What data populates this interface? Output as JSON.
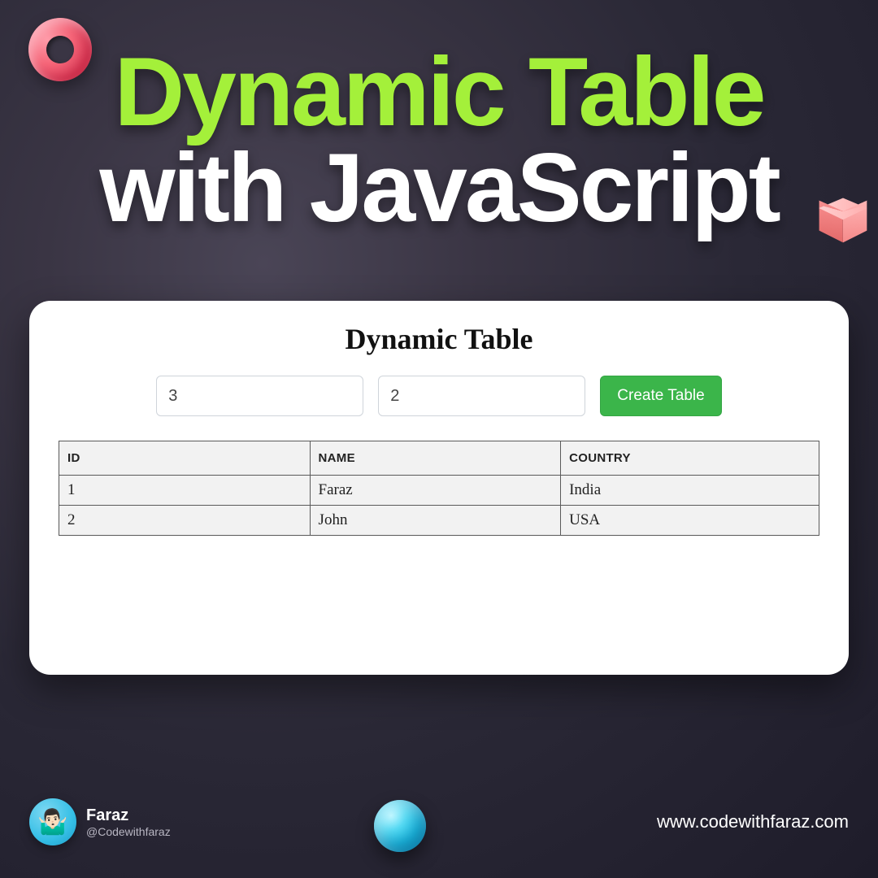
{
  "headline": {
    "line1": "Dynamic Table",
    "line2": "with JavaScript"
  },
  "card": {
    "title": "Dynamic Table",
    "inputs": {
      "rows_value": "3",
      "cols_value": "2"
    },
    "create_button_label": "Create Table",
    "table": {
      "headers": [
        "ID",
        "NAME",
        "COUNTRY"
      ],
      "rows": [
        {
          "id": "1",
          "name": "Faraz",
          "country": "India"
        },
        {
          "id": "2",
          "name": "John",
          "country": "USA"
        }
      ]
    }
  },
  "footer": {
    "author_name": "Faraz",
    "author_handle": "@Codewithfaraz",
    "avatar_emoji": "🤷🏻‍♂️",
    "website": "www.codewithfaraz.com"
  }
}
